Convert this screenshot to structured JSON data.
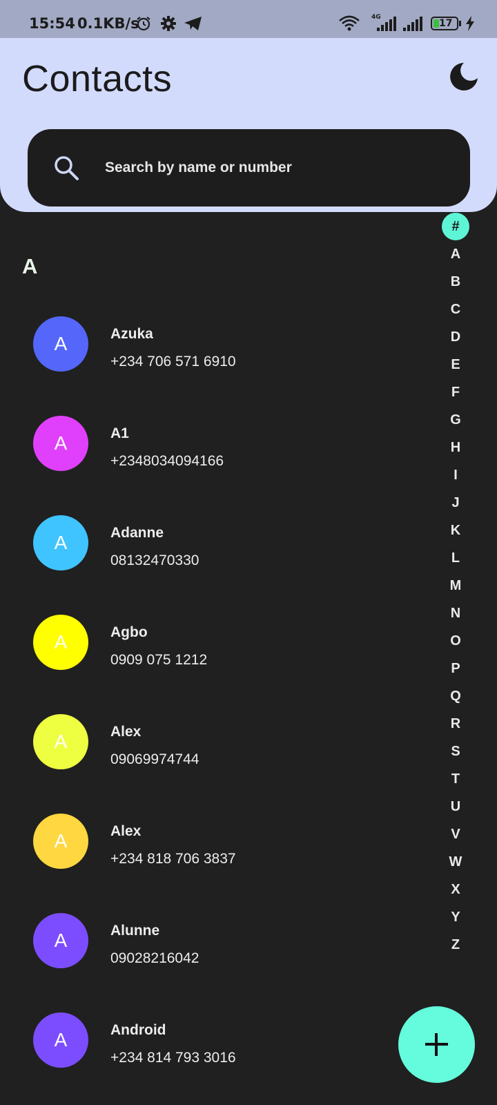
{
  "status_bar": {
    "time": "15:54",
    "net_speed": "0.1KB/s",
    "battery": "17",
    "network_type": "4G"
  },
  "header": {
    "title": "Contacts",
    "theme_icon": "moon-icon"
  },
  "search": {
    "placeholder": "Search by name or number",
    "icon": "search-icon"
  },
  "section": {
    "letter": "A"
  },
  "contacts": [
    {
      "initial": "A",
      "name": "Azuka",
      "phone": "+234 706 571 6910",
      "color": "#5467fa"
    },
    {
      "initial": "A",
      "name": "A1",
      "phone": "+2348034094166",
      "color": "#e040fb"
    },
    {
      "initial": "A",
      "name": "Adanne",
      "phone": "08132470330",
      "color": "#40c4ff"
    },
    {
      "initial": "A",
      "name": "Agbo",
      "phone": "0909 075 1212",
      "color": "#ffff00"
    },
    {
      "initial": "A",
      "name": "Alex",
      "phone": "09069974744",
      "color": "#eeff41"
    },
    {
      "initial": "A",
      "name": "Alex",
      "phone": "+234 818 706 3837",
      "color": "#ffd740"
    },
    {
      "initial": "A",
      "name": "Alunne",
      "phone": "09028216042",
      "color": "#7c4dff"
    },
    {
      "initial": "A",
      "name": "Android",
      "phone": "+234 814 793 3016",
      "color": "#7c4dff"
    }
  ],
  "alphabet_index": [
    "#",
    "A",
    "B",
    "C",
    "D",
    "E",
    "F",
    "G",
    "H",
    "I",
    "J",
    "K",
    "L",
    "M",
    "N",
    "O",
    "P",
    "Q",
    "R",
    "S",
    "T",
    "U",
    "V",
    "W",
    "X",
    "Y",
    "Z"
  ],
  "alphabet_active": "#",
  "fab": {
    "icon": "plus-icon",
    "color": "#64fcdd"
  },
  "colors": {
    "header_bg": "#d3dbfd",
    "body_bg": "#202020",
    "accent": "#5ef5d6"
  }
}
